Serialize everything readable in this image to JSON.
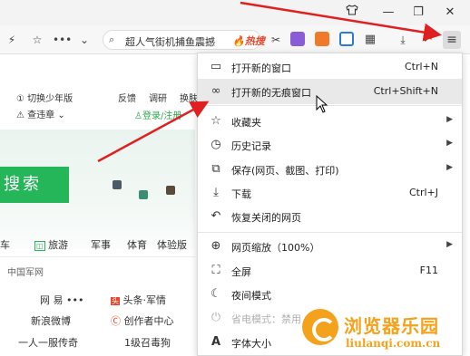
{
  "titlebar": {
    "shirt_icon": "tshirt-icon",
    "minimize": "—",
    "restore": "❐",
    "close": "✕"
  },
  "toolbar": {
    "search_text": "超人气街机捕鱼震撼",
    "hot_badge": "🔥热搜",
    "menu_icon": "≡",
    "undo_icon": "↶"
  },
  "page": {
    "switch_youth": "切换少年版",
    "checkin": "查违章",
    "feedback": "反馈",
    "survey": "调研",
    "skin": "换肤",
    "login": "登录/注册",
    "search_button": "搜索",
    "categories": [
      "车",
      "旅游",
      "军事",
      "体育",
      "体验版"
    ],
    "section_title": "中国军网",
    "links": [
      {
        "text": "网 易 •••"
      },
      {
        "text": "头条·军情"
      },
      {
        "text": "新浪微博"
      },
      {
        "text": "创作者中心"
      },
      {
        "text": "一人一服传奇"
      },
      {
        "text": "1级召毒狗"
      }
    ]
  },
  "menu": {
    "items": [
      {
        "icon": "new-window-icon",
        "label": "打开新的窗口",
        "shortcut": "Ctrl+N",
        "arrow": false
      },
      {
        "icon": "incognito-icon",
        "label": "打开新的无痕窗口",
        "shortcut": "Ctrl+Shift+N",
        "arrow": false
      },
      {
        "icon": "star-icon",
        "label": "收藏夹",
        "shortcut": "",
        "arrow": true
      },
      {
        "icon": "history-icon",
        "label": "历史记录",
        "shortcut": "",
        "arrow": true
      },
      {
        "icon": "save-page-icon",
        "label": "保存(网页、截图、打印)",
        "shortcut": "",
        "arrow": true
      },
      {
        "icon": "download-icon",
        "label": "下载",
        "shortcut": "Ctrl+J",
        "arrow": false
      },
      {
        "icon": "restore-icon",
        "label": "恢复关闭的网页",
        "shortcut": "",
        "arrow": false
      },
      {
        "icon": "zoom-icon",
        "label": "网页缩放（100%）",
        "shortcut": "",
        "arrow": true
      },
      {
        "icon": "fullscreen-icon",
        "label": "全屏",
        "shortcut": "F11",
        "arrow": false
      },
      {
        "icon": "moon-icon",
        "label": "夜间模式",
        "shortcut": "",
        "arrow": false
      },
      {
        "icon": "plug-icon",
        "label": "省电模式：禁用",
        "shortcut": "",
        "arrow": false
      },
      {
        "icon": "font-size-icon",
        "label": "字体大小",
        "shortcut": "",
        "arrow": false
      }
    ]
  },
  "watermark": {
    "title": "浏览器乐园",
    "url": "liulanqi.com.cn"
  },
  "colors": {
    "arrow": "#e02020",
    "search_button": "#26b65a",
    "watermark": "#f4a21b"
  }
}
